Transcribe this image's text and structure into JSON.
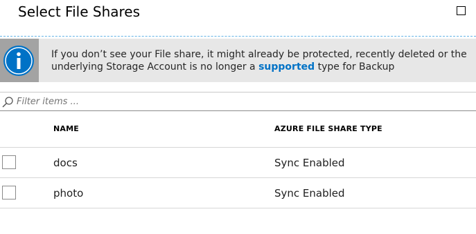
{
  "dialog": {
    "title": "Select File Shares",
    "icons": {
      "maximize": "maximize-icon",
      "info": "info-icon",
      "search": "search-icon"
    }
  },
  "banner": {
    "text_before": "If you don’t see your File share, it might already be protected, recently deleted or the underlying Storage Account is no longer a ",
    "link_text": "supported",
    "text_after": " type for Backup",
    "colors": {
      "background": "#e7e7e7",
      "icon_box": "#a3a3a3",
      "icon": "#0072c6",
      "link": "#0072c6"
    }
  },
  "filter": {
    "placeholder": "Filter items ...",
    "value": ""
  },
  "table": {
    "columns": [
      "NAME",
      "AZURE FILE SHARE TYPE"
    ],
    "rows": [
      {
        "name": "docs",
        "type": "Sync Enabled",
        "checked": false
      },
      {
        "name": "photo",
        "type": "Sync Enabled",
        "checked": false
      }
    ]
  }
}
